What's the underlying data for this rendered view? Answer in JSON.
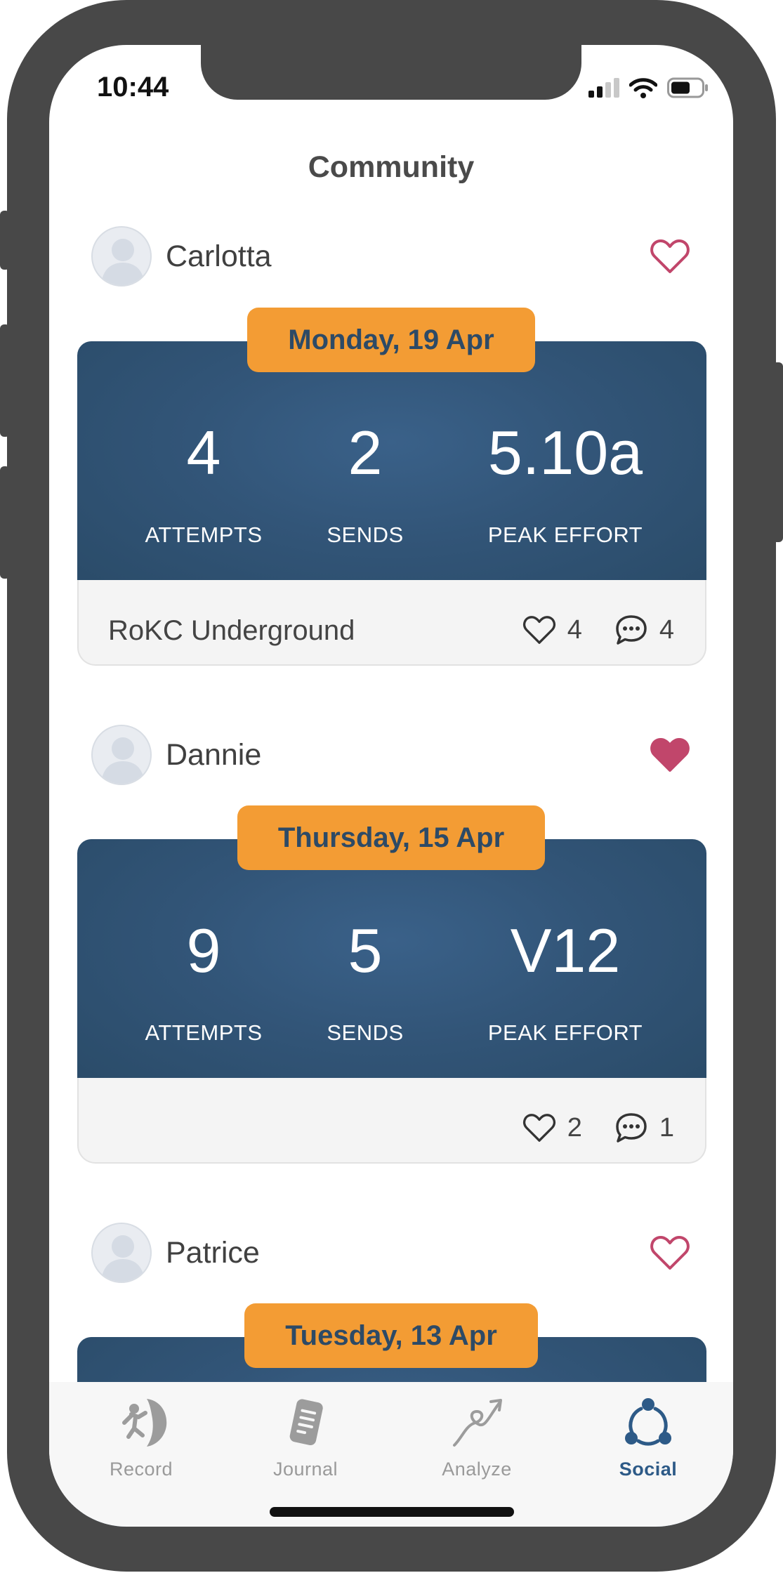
{
  "status_bar": {
    "time": "10:44"
  },
  "header": {
    "title": "Community"
  },
  "feed": [
    {
      "user": "Carlotta",
      "liked": false,
      "date": "Monday, 19 Apr",
      "stats": [
        {
          "value": "4",
          "label": "ATTEMPTS"
        },
        {
          "value": "2",
          "label": "SENDS"
        },
        {
          "value": "5.10a",
          "label": "PEAK EFFORT"
        }
      ],
      "gym": "RoKC Underground",
      "likes": "4",
      "comments": "4"
    },
    {
      "user": "Dannie",
      "liked": true,
      "date": "Thursday, 15 Apr",
      "stats": [
        {
          "value": "9",
          "label": "ATTEMPTS"
        },
        {
          "value": "5",
          "label": "SENDS"
        },
        {
          "value": "V12",
          "label": "PEAK EFFORT"
        }
      ],
      "gym": "",
      "likes": "2",
      "comments": "1"
    },
    {
      "user": "Patrice",
      "liked": false,
      "date": "Tuesday, 13 Apr"
    }
  ],
  "tabbar": {
    "tabs": [
      {
        "label": "Record",
        "icon": "climber-icon",
        "active": false
      },
      {
        "label": "Journal",
        "icon": "journal-icon",
        "active": false
      },
      {
        "label": "Analyze",
        "icon": "analyze-icon",
        "active": false
      },
      {
        "label": "Social",
        "icon": "social-icon",
        "active": true
      }
    ]
  },
  "colors": {
    "accent_orange": "#f39c34",
    "card_blue": "#325578",
    "heart_red": "#c1466b",
    "active_tab": "#2d5a87"
  }
}
